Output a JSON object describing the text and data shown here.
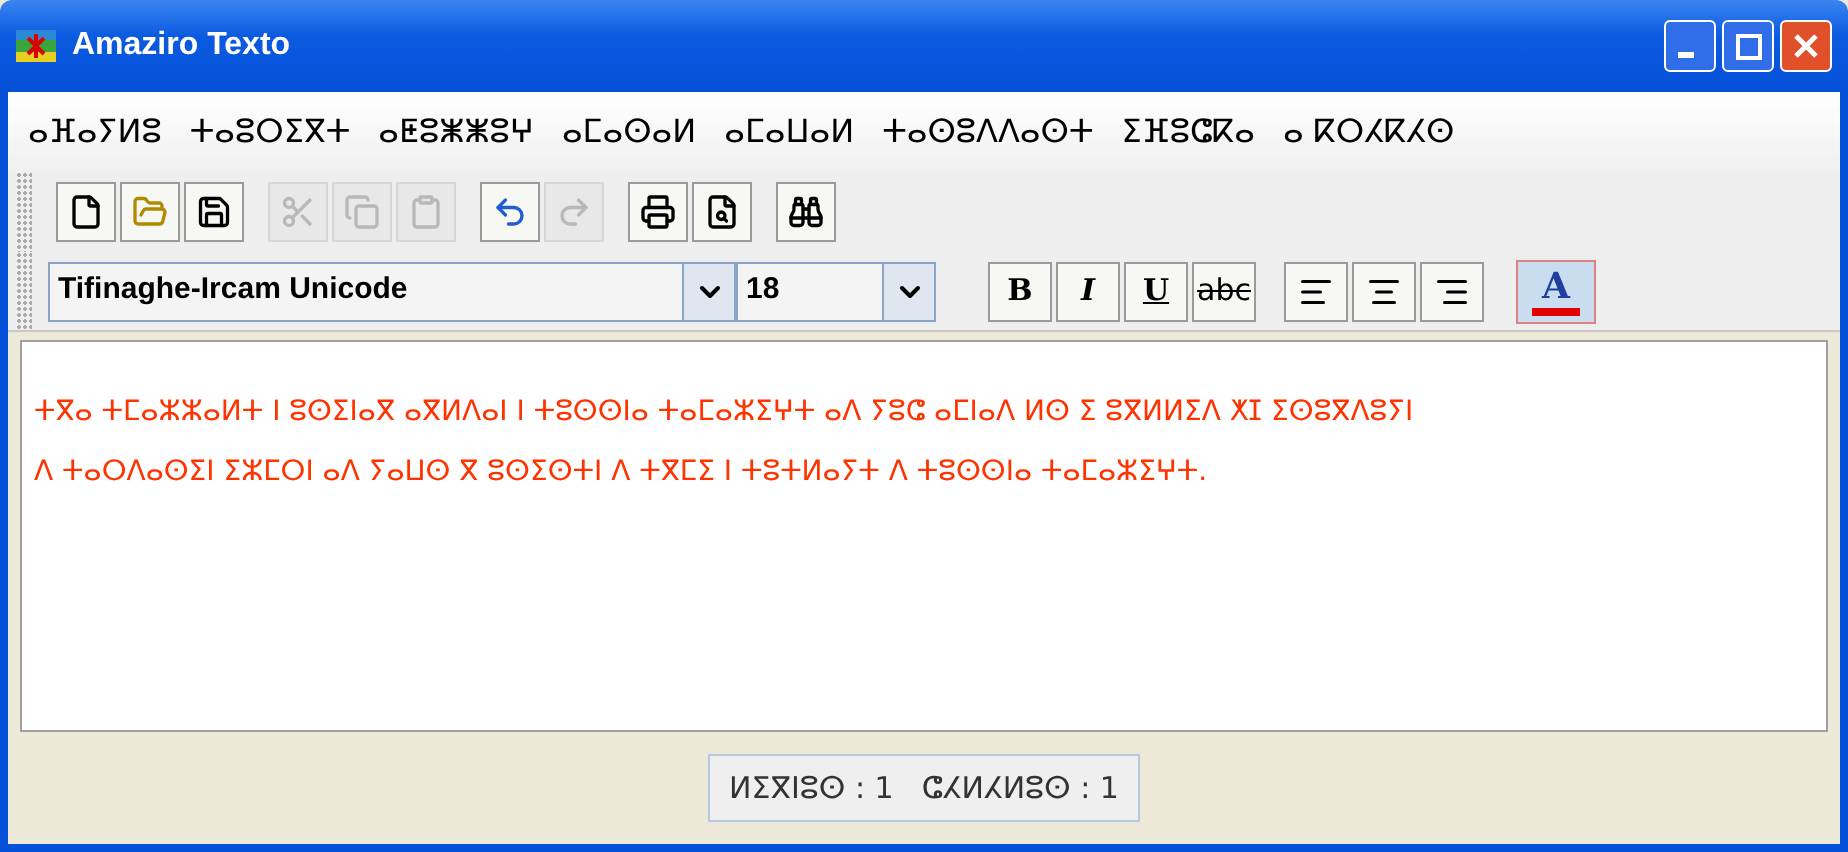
{
  "window": {
    "title": "Amaziro Texto"
  },
  "menu": [
    "ⴰⴼⴰⵢⵍⵓ",
    "ⵜⴰⵓⵔⵉⴳⵜ",
    "ⴰⵟⵓⵥⵥⵓⵖ",
    "ⴰⵎⴰⵙⴰⵍ",
    "ⴰⵎⴰⵡⴰⵍ",
    "ⵜⴰⵙⵓⴷⴷⴰⵙⵜ",
    "ⵉⴼⵓⵛⴽⴰ",
    "ⴰ ⴽⵔⵃⴽⵃⵙ"
  ],
  "toolbar": [
    [
      {
        "kind": "new",
        "disabled": false
      },
      {
        "kind": "open",
        "disabled": false
      },
      {
        "kind": "save",
        "disabled": false
      }
    ],
    [
      {
        "kind": "cut",
        "disabled": true
      },
      {
        "kind": "copy",
        "disabled": true
      },
      {
        "kind": "paste",
        "disabled": true
      }
    ],
    [
      {
        "kind": "undo",
        "disabled": false
      },
      {
        "kind": "redo",
        "disabled": true
      }
    ],
    [
      {
        "kind": "print",
        "disabled": false
      },
      {
        "kind": "preview",
        "disabled": false
      }
    ],
    [
      {
        "kind": "find",
        "disabled": false
      }
    ]
  ],
  "format": {
    "font": "Tifinaghe-Ircam Unicode",
    "size": "18",
    "styles": [
      {
        "kind": "bold",
        "label": "B"
      },
      {
        "kind": "italic",
        "label": "I"
      },
      {
        "kind": "underline",
        "label": "U"
      },
      {
        "kind": "strike",
        "label": "abc"
      }
    ],
    "align": [
      {
        "kind": "left"
      },
      {
        "kind": "center"
      },
      {
        "kind": "right"
      }
    ],
    "color_label": "A",
    "color": "#e00000"
  },
  "editor": {
    "color": "#ff3300",
    "lines": [
      "ⵜⴳⴰ ⵜⵎⴰⵣⵣⴰⵍⵜ ⵏ ⵓⵙⵉⵏⴰⴳ ⴰⴳⵍⴷⴰⵏ ⵏ ⵜⵓⵙⵙⵏⴰ ⵜⴰⵎⴰⵣⵉⵖⵜ ⴰⴷ ⵢⵓⵛ ⴰⵎⵏⴰⴷ ⵍⵙ ⵉ ⵓⴳⵍⵍⵉⴷ ⵅⵊ ⵉⵙⵓⴳⴷⵓⵢⵏ",
      "ⴷ ⵜⴰⵔⴷⴰⵙⵉⵏ ⵉⵣⵎⵔⵏ ⴰⴷ ⵢⴰⵡⵙ ⴳ ⵓⵙⵉⵙⵜⵏ ⴷ ⵜⴳⵎⵉ ⵏ ⵜⵓⵜⵍⴰⵢⵜ ⴷ ⵜⵓⵙⵙⵏⴰ ⵜⴰⵎⴰⵣⵉⵖⵜ."
    ]
  },
  "status_bar": {
    "line": "ⵍⵉⴳⵏⵓⵙ : 1",
    "column": "ⵛⵃⵍⵃⵍⵓⵙ : 1"
  }
}
